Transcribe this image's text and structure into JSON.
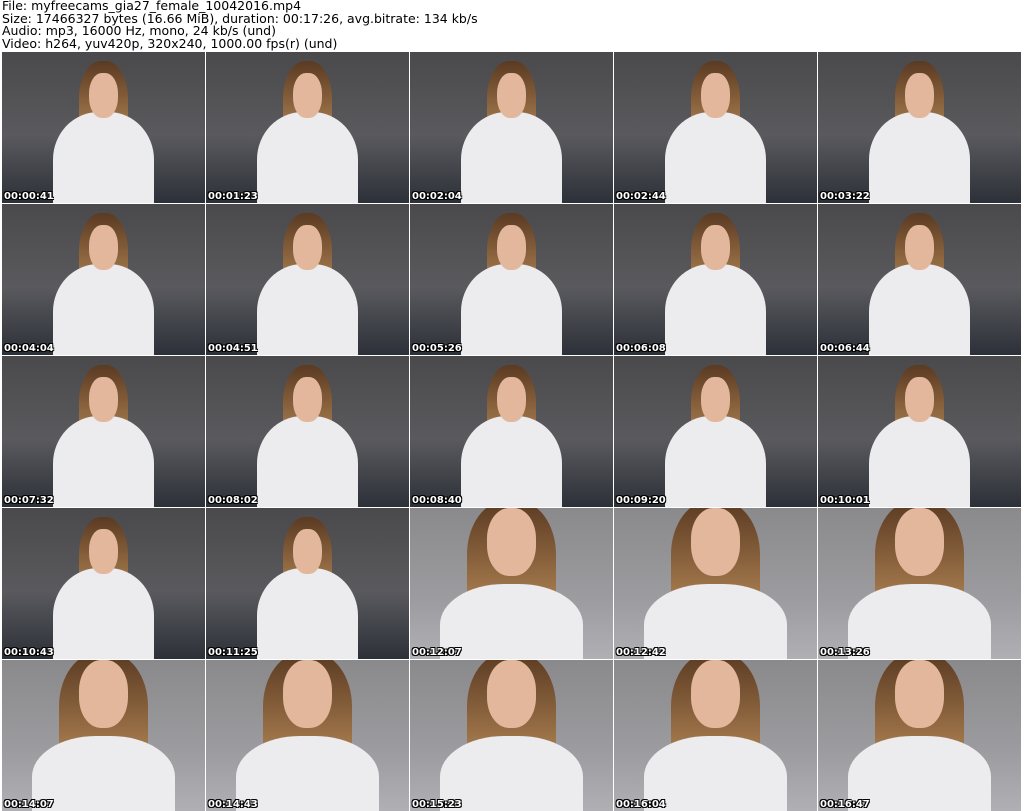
{
  "header": {
    "file": "File: myfreecams_gia27_female_10042016.mp4",
    "size": "Size: 17466327 bytes (16.66 MiB), duration: 00:17:26, avg.bitrate: 134 kb/s",
    "audio": "Audio: mp3, 16000 Hz, mono, 24 kb/s (und)",
    "video": "Video: h264, yuv420p, 320x240, 1000.00 fps(r) (und)"
  },
  "thumbnails": [
    {
      "time": "00:00:41"
    },
    {
      "time": "00:01:23"
    },
    {
      "time": "00:02:04"
    },
    {
      "time": "00:02:44"
    },
    {
      "time": "00:03:22"
    },
    {
      "time": "00:04:04"
    },
    {
      "time": "00:04:51"
    },
    {
      "time": "00:05:26"
    },
    {
      "time": "00:06:08"
    },
    {
      "time": "00:06:44"
    },
    {
      "time": "00:07:32"
    },
    {
      "time": "00:08:02"
    },
    {
      "time": "00:08:40"
    },
    {
      "time": "00:09:20"
    },
    {
      "time": "00:10:01"
    },
    {
      "time": "00:10:43"
    },
    {
      "time": "00:11:25"
    },
    {
      "time": "00:12:07"
    },
    {
      "time": "00:12:42"
    },
    {
      "time": "00:13:26"
    },
    {
      "time": "00:14:07"
    },
    {
      "time": "00:14:43"
    },
    {
      "time": "00:15:23"
    },
    {
      "time": "00:16:04"
    },
    {
      "time": "00:16:47"
    }
  ]
}
